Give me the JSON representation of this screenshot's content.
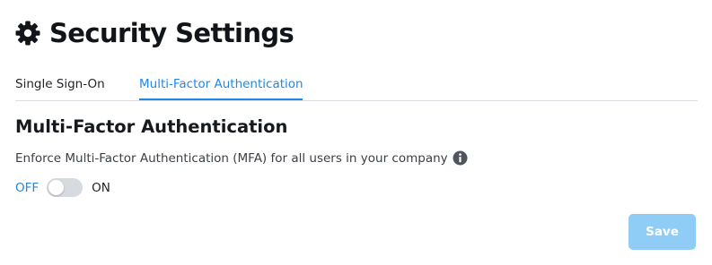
{
  "header": {
    "icon": "gear-icon",
    "title": "Security Settings"
  },
  "tabs": [
    {
      "label": "Single Sign-On",
      "active": false
    },
    {
      "label": "Multi-Factor Authentication",
      "active": true
    }
  ],
  "section": {
    "title": "Multi-Factor Authentication",
    "description": "Enforce Multi-Factor Authentication (MFA) for all users in your company",
    "info_icon": "info-icon"
  },
  "toggle": {
    "off_label": "OFF",
    "on_label": "ON",
    "state": "off"
  },
  "actions": {
    "save_label": "Save"
  },
  "colors": {
    "accent": "#1f88e5",
    "save_disabled_bg": "#8fcdf6",
    "toggle_track": "#d7dbe0",
    "divider": "#dadde1"
  }
}
